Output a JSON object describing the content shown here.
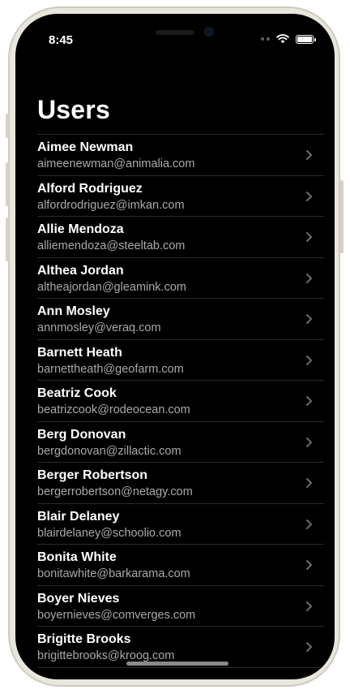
{
  "status_bar": {
    "time": "8:45",
    "icons": [
      "signal-dots-icon",
      "wifi-icon",
      "battery-icon"
    ]
  },
  "header": {
    "title": "Users"
  },
  "users": [
    {
      "name": "Aimee Newman",
      "email": "aimeenewman@animalia.com"
    },
    {
      "name": "Alford Rodriguez",
      "email": "alfordrodriguez@imkan.com"
    },
    {
      "name": "Allie Mendoza",
      "email": "alliemendoza@steeltab.com"
    },
    {
      "name": "Althea Jordan",
      "email": "altheajordan@gleamink.com"
    },
    {
      "name": "Ann Mosley",
      "email": "annmosley@veraq.com"
    },
    {
      "name": "Barnett Heath",
      "email": "barnettheath@geofarm.com"
    },
    {
      "name": "Beatriz Cook",
      "email": "beatrizcook@rodeocean.com"
    },
    {
      "name": "Berg Donovan",
      "email": "bergdonovan@zillactic.com"
    },
    {
      "name": "Berger Robertson",
      "email": "bergerrobertson@netagy.com"
    },
    {
      "name": "Blair Delaney",
      "email": "blairdelaney@schoolio.com"
    },
    {
      "name": "Bonita White",
      "email": "bonitawhite@barkarama.com"
    },
    {
      "name": "Boyer Nieves",
      "email": "boyernieves@comverges.com"
    },
    {
      "name": "Brigitte Brooks",
      "email": "brigittebrooks@kroog.com"
    }
  ],
  "colors": {
    "background": "#000000",
    "text_primary": "#ffffff",
    "text_secondary": "#a9a9ae",
    "separator": "#2a2a2c",
    "chevron": "#6d6d72"
  }
}
